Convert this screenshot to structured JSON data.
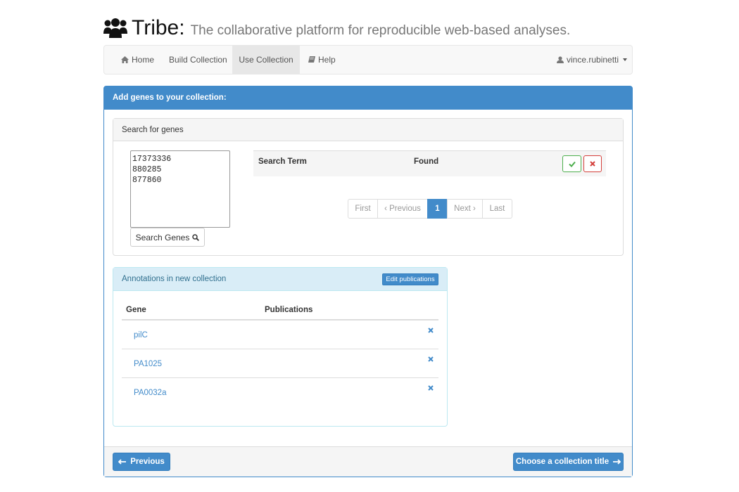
{
  "header": {
    "title": "Tribe:",
    "subtitle": "The collaborative platform for reproducible web-based analyses.",
    "icon": "users-icon"
  },
  "nav": {
    "items": [
      {
        "label": "Home",
        "icon": "home-icon"
      },
      {
        "label": "Build Collection"
      },
      {
        "label": "Use Collection",
        "active": true
      },
      {
        "label": "Help",
        "icon": "book-icon"
      }
    ],
    "user": {
      "label": "vince.rubinetti",
      "icon": "user-icon"
    }
  },
  "panel": {
    "title": "Add genes to your collection:"
  },
  "search": {
    "title": "Search for genes",
    "textarea_value": "17373336\n880285\n877860",
    "button_label": "Search Genes",
    "table_headers": [
      "Search Term",
      "Found"
    ],
    "pagination": [
      "First",
      "‹ Previous",
      "1",
      "Next ›",
      "Last"
    ],
    "current_page": "1"
  },
  "annotations": {
    "title": "Annotations in new collection",
    "edit_button": "Edit publications",
    "headers": [
      "Gene",
      "Publications"
    ],
    "rows": [
      {
        "gene": "pilC"
      },
      {
        "gene": "PA1025"
      },
      {
        "gene": "PA0032a"
      }
    ]
  },
  "footer": {
    "previous_label": "Previous",
    "next_label": "Choose a collection title"
  },
  "colors": {
    "primary": "#428bca",
    "success": "#4cae4c",
    "danger": "#d43f3a",
    "info_bg": "#d9edf7"
  }
}
